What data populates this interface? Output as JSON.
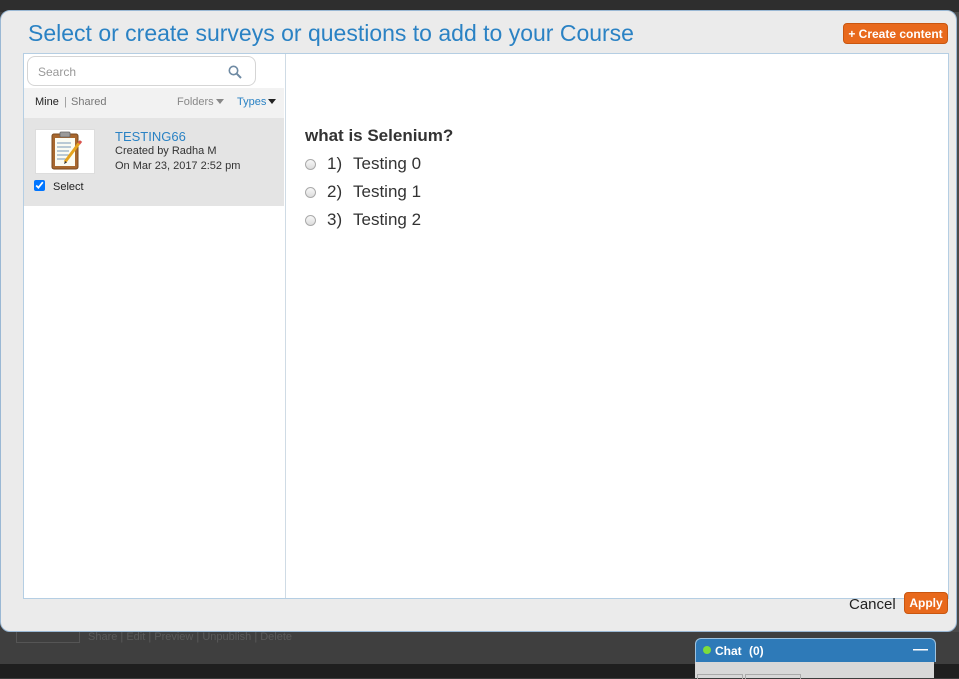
{
  "dialog": {
    "title": "Select or create surveys or questions to add to your Course",
    "create_button": "+ Create content",
    "cancel": "Cancel",
    "apply": "Apply"
  },
  "search": {
    "placeholder": "Search",
    "value": ""
  },
  "filters": {
    "mine": "Mine",
    "separator": "|",
    "shared": "Shared",
    "folders": "Folders",
    "types": "Types"
  },
  "items": [
    {
      "title": "TESTING66",
      "created_by": "Created by Radha M",
      "date": "On Mar 23, 2017 2:52 pm",
      "select_label": "Select",
      "checked": true
    }
  ],
  "preview": {
    "question": "what is Selenium?",
    "options": [
      {
        "num": "1)",
        "text": "Testing 0"
      },
      {
        "num": "2)",
        "text": "Testing 1"
      },
      {
        "num": "3)",
        "text": "Testing 2"
      }
    ]
  },
  "background": {
    "links": "Share  |  Edit  |  Preview  |  Unpublish  |  Delete"
  },
  "chat": {
    "label": "Chat",
    "count": "(0)",
    "minimize": "—"
  },
  "colors": {
    "accent": "#2a82c4",
    "button": "#e8691c"
  }
}
